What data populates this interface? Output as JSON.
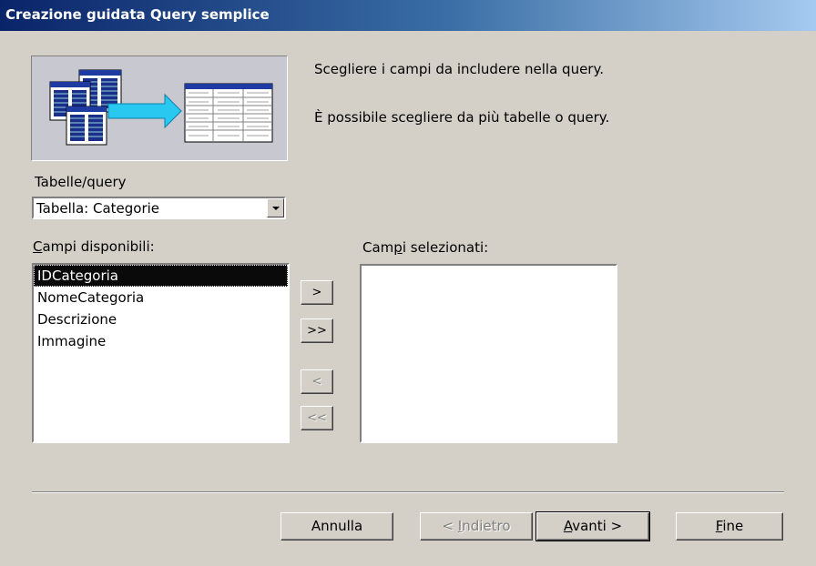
{
  "window": {
    "title": "Creazione guidata Query semplice"
  },
  "intro": {
    "line1": "Scegliere i campi da includere nella query.",
    "line2": "È possibile scegliere da più tabelle o query."
  },
  "tables": {
    "label": "Tabelle/query",
    "selected": "Tabella: Categorie"
  },
  "available": {
    "label_prefix": "",
    "label_mnemonic": "C",
    "label_rest": "ampi disponibili:",
    "items": [
      "IDCategoria",
      "NomeCategoria",
      "Descrizione",
      "Immagine"
    ],
    "selected_index": 0
  },
  "selected_fields": {
    "label_prefix": "Cam",
    "label_mnemonic": "p",
    "label_rest": "i selezionati:",
    "items": []
  },
  "move_buttons": {
    "add_one": ">",
    "add_all": ">>",
    "remove_one": "<",
    "remove_all": "<<"
  },
  "buttons": {
    "cancel": "Annulla",
    "back_prefix": "< ",
    "back_mnemonic": "I",
    "back_rest": "ndietro",
    "next_mnemonic": "A",
    "next_rest": "vanti >",
    "finish_mnemonic": "F",
    "finish_rest": "ine"
  }
}
